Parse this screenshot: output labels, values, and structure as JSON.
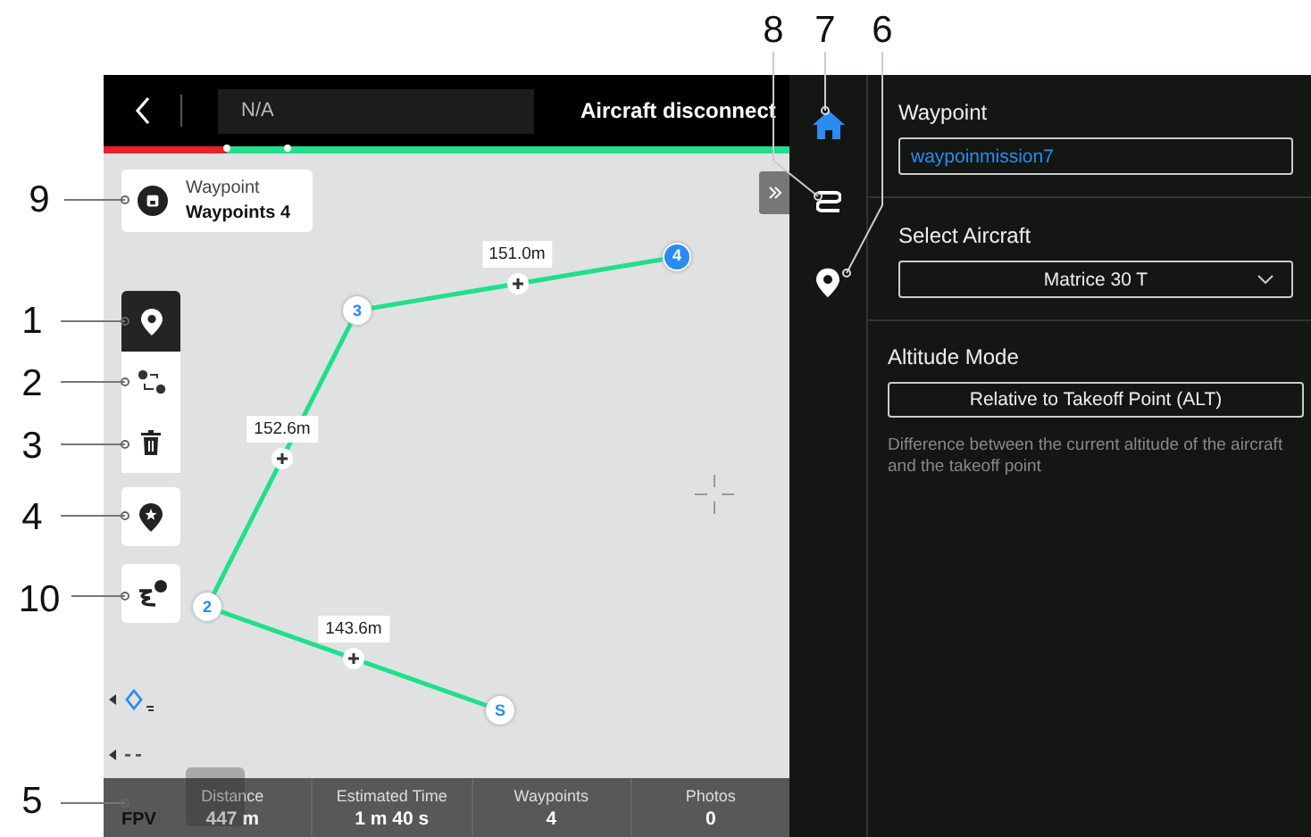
{
  "callouts": [
    {
      "label": "8"
    },
    {
      "label": "7"
    },
    {
      "label": "6"
    },
    {
      "label": "9"
    },
    {
      "label": "1"
    },
    {
      "label": "2"
    },
    {
      "label": "3"
    },
    {
      "label": "4"
    },
    {
      "label": "10"
    },
    {
      "label": "5"
    }
  ],
  "top_bar": {
    "field": "N/A",
    "status": "Aircraft disconnect"
  },
  "mission_card": {
    "title": "Waypoint",
    "subtitle": "Waypoints 4"
  },
  "tools": [
    {
      "kind": "waypoint",
      "selected": true
    },
    {
      "kind": "reverse",
      "selected": false
    },
    {
      "kind": "delete",
      "selected": false
    },
    {
      "kind": "poi",
      "selected": false
    },
    {
      "kind": "trajectory",
      "selected": false
    }
  ],
  "waypoints": [
    {
      "label": "S",
      "selected": false
    },
    {
      "label": "2",
      "selected": false
    },
    {
      "label": "3",
      "selected": false
    },
    {
      "label": "4",
      "selected": true
    }
  ],
  "segments": [
    {
      "distance": "143.6m"
    },
    {
      "distance": "152.6m"
    },
    {
      "distance": "151.0m"
    }
  ],
  "fpv": "FPV",
  "stats": [
    {
      "label": "Distance",
      "value": "447 m"
    },
    {
      "label": "Estimated Time",
      "value": "1 m 40 s"
    },
    {
      "label": "Waypoints",
      "value": "4"
    },
    {
      "label": "Photos",
      "value": "0"
    }
  ],
  "side_nav": [
    {
      "kind": "home",
      "selected": true
    },
    {
      "kind": "route",
      "selected": false
    },
    {
      "kind": "pin",
      "selected": false
    }
  ],
  "panel": {
    "name_label": "Waypoint",
    "name_value": "waypoinmission7",
    "aircraft_label": "Select Aircraft",
    "aircraft": "Matrice 30 T",
    "altitude_label": "Altitude Mode",
    "altitude_mode": "Relative to Takeoff Point (ALT)",
    "altitude_hint": "Difference between the current altitude of the aircraft and the takeoff point"
  }
}
